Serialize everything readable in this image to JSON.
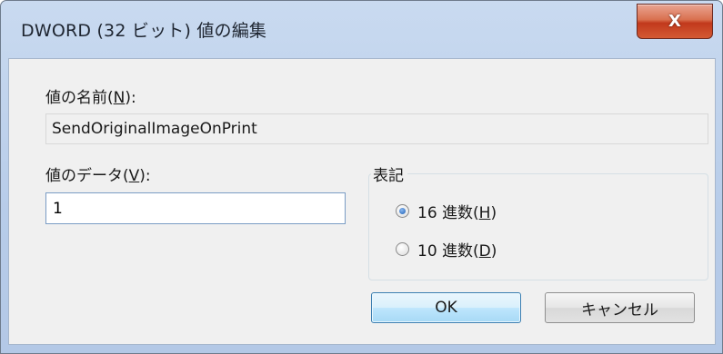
{
  "window": {
    "title": "DWORD (32 ビット) 値の編集",
    "close_label": "X"
  },
  "fields": {
    "name_label_prefix": "値の名前(",
    "name_label_key": "N",
    "name_label_suffix": "):",
    "name_value": "SendOriginalImageOnPrint",
    "data_label_prefix": "値のデータ(",
    "data_label_key": "V",
    "data_label_suffix": "):",
    "data_value": "1"
  },
  "base": {
    "legend": "表記",
    "options": [
      {
        "prefix": "16 進数(",
        "key": "H",
        "suffix": ")",
        "checked": true
      },
      {
        "prefix": "10 進数(",
        "key": "D",
        "suffix": ")",
        "checked": false
      }
    ]
  },
  "buttons": {
    "ok_label": "OK",
    "cancel_label": "キャンセル"
  },
  "colors": {
    "titlebar": "#c9daf0",
    "close_button": "#c2391c",
    "client_background": "#f0f0f0",
    "default_button_border": "#3c7fb1"
  }
}
